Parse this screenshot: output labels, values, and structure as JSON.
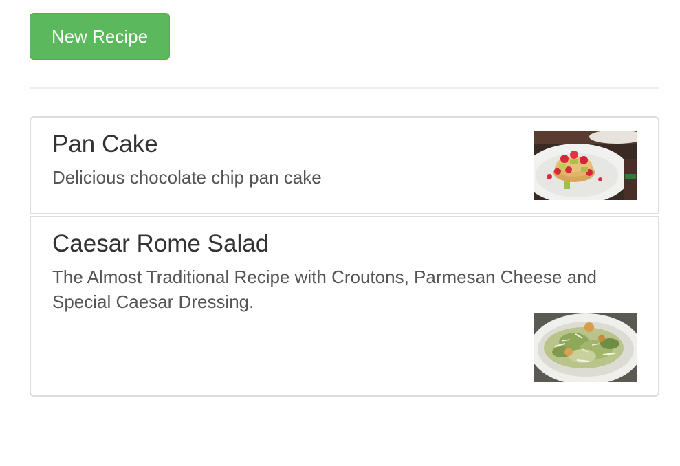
{
  "toolbar": {
    "new_recipe_label": "New Recipe",
    "button_color": "#5cb85c"
  },
  "recipes": [
    {
      "title": "Pan Cake",
      "description": "Delicious chocolate chip pan cake",
      "image_alt": "pancake stack with strawberries"
    },
    {
      "title": "Caesar Rome Salad",
      "description": "The Almost Traditional Recipe with Croutons, Parmesan Cheese and Special Caesar Dressing.",
      "image_alt": "caesar salad plate"
    }
  ]
}
